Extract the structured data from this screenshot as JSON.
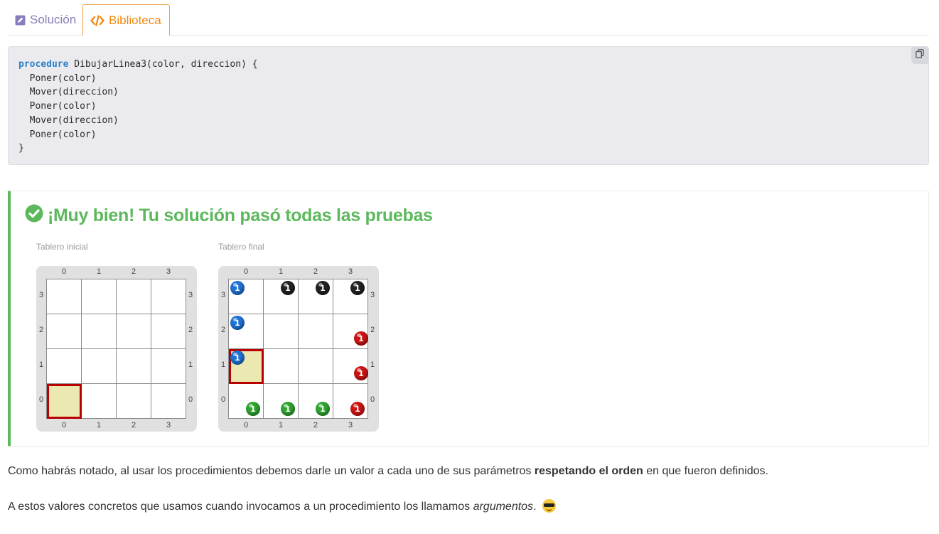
{
  "tabs": {
    "solution": "Solución",
    "library": "Biblioteca"
  },
  "code": {
    "keyword": "procedure",
    "signature": " DibujarLinea3(color, direccion) {",
    "body": [
      "  Poner(color)",
      "  Mover(direccion)",
      "  Poner(color)",
      "  Mover(direccion)",
      "  Poner(color)"
    ],
    "closing": "}",
    "copy_icon": "copy-icon"
  },
  "result": {
    "title": "¡Muy bien! Tu solución pasó todas las pruebas",
    "status_icon": "check-circle-icon",
    "initial_caption": "Tablero inicial",
    "final_caption": "Tablero final"
  },
  "boards": {
    "col_labels": [
      "0",
      "1",
      "2",
      "3"
    ],
    "row_labels": [
      "3",
      "2",
      "1",
      "0"
    ],
    "initial": {
      "head": [
        0,
        0
      ],
      "balls": []
    },
    "final": {
      "head": [
        0,
        1
      ],
      "balls": [
        {
          "col": 0,
          "row": 3,
          "color": "blue",
          "count": "1"
        },
        {
          "col": 1,
          "row": 3,
          "color": "black",
          "count": "1"
        },
        {
          "col": 2,
          "row": 3,
          "color": "black",
          "count": "1"
        },
        {
          "col": 3,
          "row": 3,
          "color": "black",
          "count": "1"
        },
        {
          "col": 0,
          "row": 2,
          "color": "blue",
          "count": "1"
        },
        {
          "col": 3,
          "row": 2,
          "color": "red",
          "count": "1"
        },
        {
          "col": 0,
          "row": 1,
          "color": "blue",
          "count": "1"
        },
        {
          "col": 3,
          "row": 1,
          "color": "red",
          "count": "1"
        },
        {
          "col": 0,
          "row": 0,
          "color": "green",
          "count": "1"
        },
        {
          "col": 1,
          "row": 0,
          "color": "green",
          "count": "1"
        },
        {
          "col": 2,
          "row": 0,
          "color": "green",
          "count": "1"
        },
        {
          "col": 3,
          "row": 0,
          "color": "red",
          "count": "1"
        }
      ]
    }
  },
  "explanation": {
    "p1_before": "Como habrás notado, al usar los procedimientos debemos darle un valor a cada uno de sus parámetros ",
    "p1_bold": "respetando el orden",
    "p1_after": " en que fueron definidos.",
    "p2_before": "A estos valores concretos que usamos cuando invocamos a un procedimiento los llamamos ",
    "p2_italic": "argumentos",
    "p2_after": ".",
    "emoji": "smiling-face-with-sunglasses"
  },
  "colors": {
    "success": "#5cb85c",
    "library_tab": "#f0890e",
    "solution_tab": "#8a7dbd",
    "keyword": "#2d7fc6",
    "head_border": "#b80000"
  }
}
